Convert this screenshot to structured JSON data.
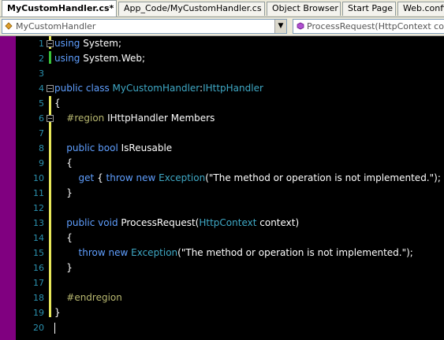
{
  "tabs": [
    {
      "label": "MyCustomHandler.cs*",
      "active": true
    },
    {
      "label": "App_Code/MyCustomHandler.cs",
      "active": false
    },
    {
      "label": "Object Browser",
      "active": false
    },
    {
      "label": "Start Page",
      "active": false
    },
    {
      "label": "Web.config",
      "active": false
    }
  ],
  "navbar": {
    "class_combo": "MyCustomHandler",
    "member_combo": "ProcessRequest(HttpContext conte"
  },
  "code_lines": [
    {
      "n": "1",
      "tokens": [
        [
          "kw",
          "using"
        ],
        [
          "",
          "System;"
        ]
      ]
    },
    {
      "n": "2",
      "tokens": [
        [
          "kw",
          "using"
        ],
        [
          "",
          "System.Web;"
        ]
      ]
    },
    {
      "n": "3",
      "tokens": []
    },
    {
      "n": "4",
      "tokens": [
        [
          "kw",
          "public class"
        ],
        [
          "ty",
          "MyCustomHandler"
        ],
        [
          "",
          ":"
        ],
        [
          "ty",
          "IHttpHandler"
        ]
      ]
    },
    {
      "n": "5",
      "tokens": [
        [
          "",
          "{"
        ]
      ]
    },
    {
      "n": "6",
      "tokens": [
        [
          "rg",
          "    #region"
        ],
        [
          "",
          "IHttpHandler Members"
        ]
      ]
    },
    {
      "n": "7",
      "tokens": []
    },
    {
      "n": "8",
      "tokens": [
        [
          "kw",
          "    public bool"
        ],
        [
          "",
          "IsReusable"
        ]
      ]
    },
    {
      "n": "9",
      "tokens": [
        [
          "",
          "    {"
        ]
      ]
    },
    {
      "n": "10",
      "tokens": [
        [
          "kw",
          "        get"
        ],
        [
          "",
          "{"
        ],
        [
          "kw",
          "throw new"
        ],
        [
          "ty",
          "Exception"
        ],
        [
          "",
          "(\"The method or operation is not implemented.\"); }"
        ]
      ]
    },
    {
      "n": "11",
      "tokens": [
        [
          "",
          "    }"
        ]
      ]
    },
    {
      "n": "12",
      "tokens": []
    },
    {
      "n": "13",
      "tokens": [
        [
          "kw",
          "    public void"
        ],
        [
          "",
          "ProcessRequest("
        ],
        [
          "ty",
          "HttpContext"
        ],
        [
          "",
          "context)"
        ]
      ]
    },
    {
      "n": "14",
      "tokens": [
        [
          "",
          "    {"
        ]
      ]
    },
    {
      "n": "15",
      "tokens": [
        [
          "kw",
          "        throw new"
        ],
        [
          "ty",
          "Exception"
        ],
        [
          "",
          "(\"The method or operation is not implemented.\");"
        ]
      ]
    },
    {
      "n": "16",
      "tokens": [
        [
          "",
          "    }"
        ]
      ]
    },
    {
      "n": "17",
      "tokens": []
    },
    {
      "n": "18",
      "tokens": [
        [
          "rg",
          "    #endregion"
        ]
      ]
    },
    {
      "n": "19",
      "tokens": [
        [
          "",
          "}"
        ]
      ]
    },
    {
      "n": "20",
      "tokens": []
    }
  ],
  "colors": {
    "background": "#000000",
    "keyword": "#5f9fff",
    "type": "#3fa9c6",
    "region": "#b8b870",
    "line_number": "#2b91af",
    "selection_margin": "#800080",
    "changed_unsaved": "#e8e85a",
    "changed_saved": "#39c239"
  }
}
